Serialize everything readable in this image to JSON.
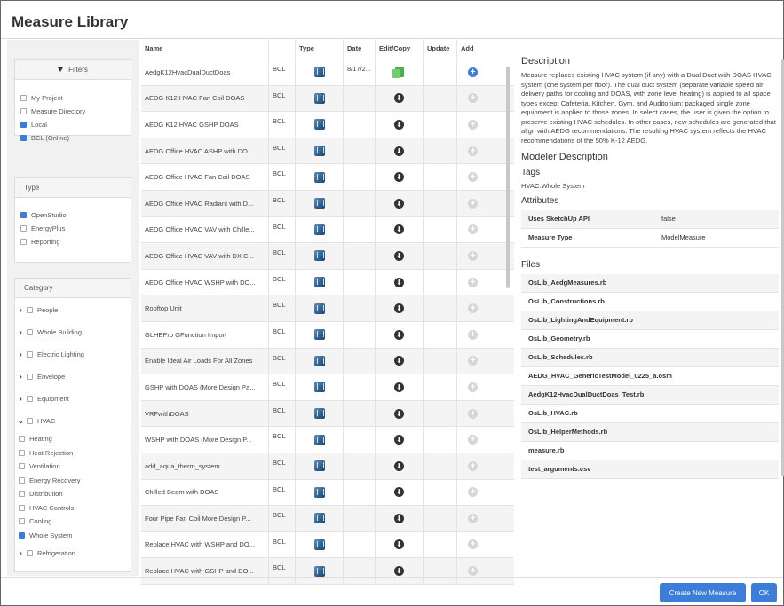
{
  "title": "Measure Library",
  "filters": {
    "header": "Filters",
    "items": [
      {
        "label": "My Project",
        "checked": false
      },
      {
        "label": "Measure Directory",
        "checked": false
      },
      {
        "label": "Local",
        "checked": true
      },
      {
        "label": "BCL (Online)",
        "checked": true
      }
    ]
  },
  "type_panel": {
    "header": "Type",
    "items": [
      {
        "label": "OpenStudio",
        "checked": true
      },
      {
        "label": "EnergyPlus",
        "checked": false
      },
      {
        "label": "Reporting",
        "checked": false
      }
    ]
  },
  "category": {
    "header": "Category",
    "items": [
      "People",
      "Whole Building",
      "Electric Lighting",
      "Envelope",
      "Equipment"
    ],
    "hvac": "HVAC",
    "hvac_sub": [
      {
        "label": "Heating",
        "checked": false
      },
      {
        "label": "Heat Rejection",
        "checked": false
      },
      {
        "label": "Ventilation",
        "checked": false
      },
      {
        "label": "Energy Recovery",
        "checked": false
      },
      {
        "label": "Distribution",
        "checked": false
      },
      {
        "label": "HVAC Controls",
        "checked": false
      },
      {
        "label": "Cooling",
        "checked": false
      },
      {
        "label": "Whole System",
        "checked": true
      }
    ],
    "after": "Refrigeration"
  },
  "table": {
    "headers": {
      "name": "Name",
      "type": "Type",
      "date": "Date",
      "edit": "Edit/Copy",
      "update": "Update",
      "add": "Add"
    },
    "rows": [
      {
        "name": "AedgK12HvacDualDuctDoas",
        "source": "BCL",
        "date": "8/17/2...",
        "local": true
      },
      {
        "name": "AEDG K12 HVAC Fan Coil DOAS",
        "source": "BCL",
        "date": "",
        "local": false
      },
      {
        "name": "AEDG K12 HVAC GSHP DOAS",
        "source": "BCL",
        "date": "",
        "local": false
      },
      {
        "name": "AEDG Office HVAC ASHP with DO...",
        "source": "BCL",
        "date": "",
        "local": false
      },
      {
        "name": "AEDG Office HVAC Fan Coil DOAS",
        "source": "BCL",
        "date": "",
        "local": false
      },
      {
        "name": "AEDG Office HVAC Radiant with D...",
        "source": "BCL",
        "date": "",
        "local": false
      },
      {
        "name": "AEDG Office HVAC VAV with Chille...",
        "source": "BCL",
        "date": "",
        "local": false
      },
      {
        "name": "AEDG Office HVAC VAV with DX C...",
        "source": "BCL",
        "date": "",
        "local": false
      },
      {
        "name": "AEDG Office HVAC WSHP with DO...",
        "source": "BCL",
        "date": "",
        "local": false
      },
      {
        "name": "Rooftop Unit",
        "source": "BCL",
        "date": "",
        "local": false
      },
      {
        "name": "GLHEPro GFunction Import",
        "source": "BCL",
        "date": "",
        "local": false
      },
      {
        "name": "Enable Ideal Air Loads For All Zones",
        "source": "BCL",
        "date": "",
        "local": false
      },
      {
        "name": "GSHP with DOAS (More Design Pa...",
        "source": "BCL",
        "date": "",
        "local": false
      },
      {
        "name": "VRFwithDOAS",
        "source": "BCL",
        "date": "",
        "local": false
      },
      {
        "name": "WSHP with DOAS (More Design P...",
        "source": "BCL",
        "date": "",
        "local": false
      },
      {
        "name": "add_aqua_therm_system",
        "source": "BCL",
        "date": "",
        "local": false
      },
      {
        "name": "Chilled Beam with DOAS",
        "source": "BCL",
        "date": "",
        "local": false
      },
      {
        "name": "Four Pipe Fan Coil More Design P...",
        "source": "BCL",
        "date": "",
        "local": false
      },
      {
        "name": "Replace HVAC with WSHP and DO...",
        "source": "BCL",
        "date": "",
        "local": false
      },
      {
        "name": "Replace HVAC with GSHP and DO...",
        "source": "BCL",
        "date": "",
        "local": false
      }
    ]
  },
  "details": {
    "description_heading": "Description",
    "description": "Measure replaces existing HVAC system (if any) with a Dual Duct with DOAS HVAC system (one system per floor). The dual duct system (separate variable speed air delivery paths for cooling and DOAS, with zone level heating) is applied to all space types except Cafeteria, Kitchen, Gym, and Auditorium; packaged single zone equipment is applied to those zones. In select cases, the user is given the option to preserve existing HVAC schedules. In other cases, new schedules are generated that align with AEDG recommendations. The resulting HVAC system reflects the HVAC recommendations of the 50% K-12 AEDG.",
    "modeler_heading": "Modeler Description",
    "tags_heading": "Tags",
    "tags": "HVAC.Whole System",
    "attributes_heading": "Attributes",
    "attributes": [
      {
        "key": "Uses SketchUp API",
        "value": "false"
      },
      {
        "key": "Measure Type",
        "value": "ModelMeasure"
      }
    ],
    "files_heading": "Files",
    "files": [
      "OsLib_AedgMeasures.rb",
      "OsLib_Constructions.rb",
      "OsLib_LightingAndEquipment.rb",
      "OsLib_Geometry.rb",
      "OsLib_Schedules.rb",
      "AEDG_HVAC_GenericTestModel_0225_a.osm",
      "AedgK12HvacDualDuctDoas_Test.rb",
      "OsLib_HVAC.rb",
      "OsLib_HelperMethods.rb",
      "measure.rb",
      "test_arguments.csv"
    ]
  },
  "buttons": {
    "create": "Create New Measure",
    "ok": "OK"
  },
  "colors": {
    "accent": "#3b7dd8",
    "panel_bg": "#f1f1f1"
  }
}
